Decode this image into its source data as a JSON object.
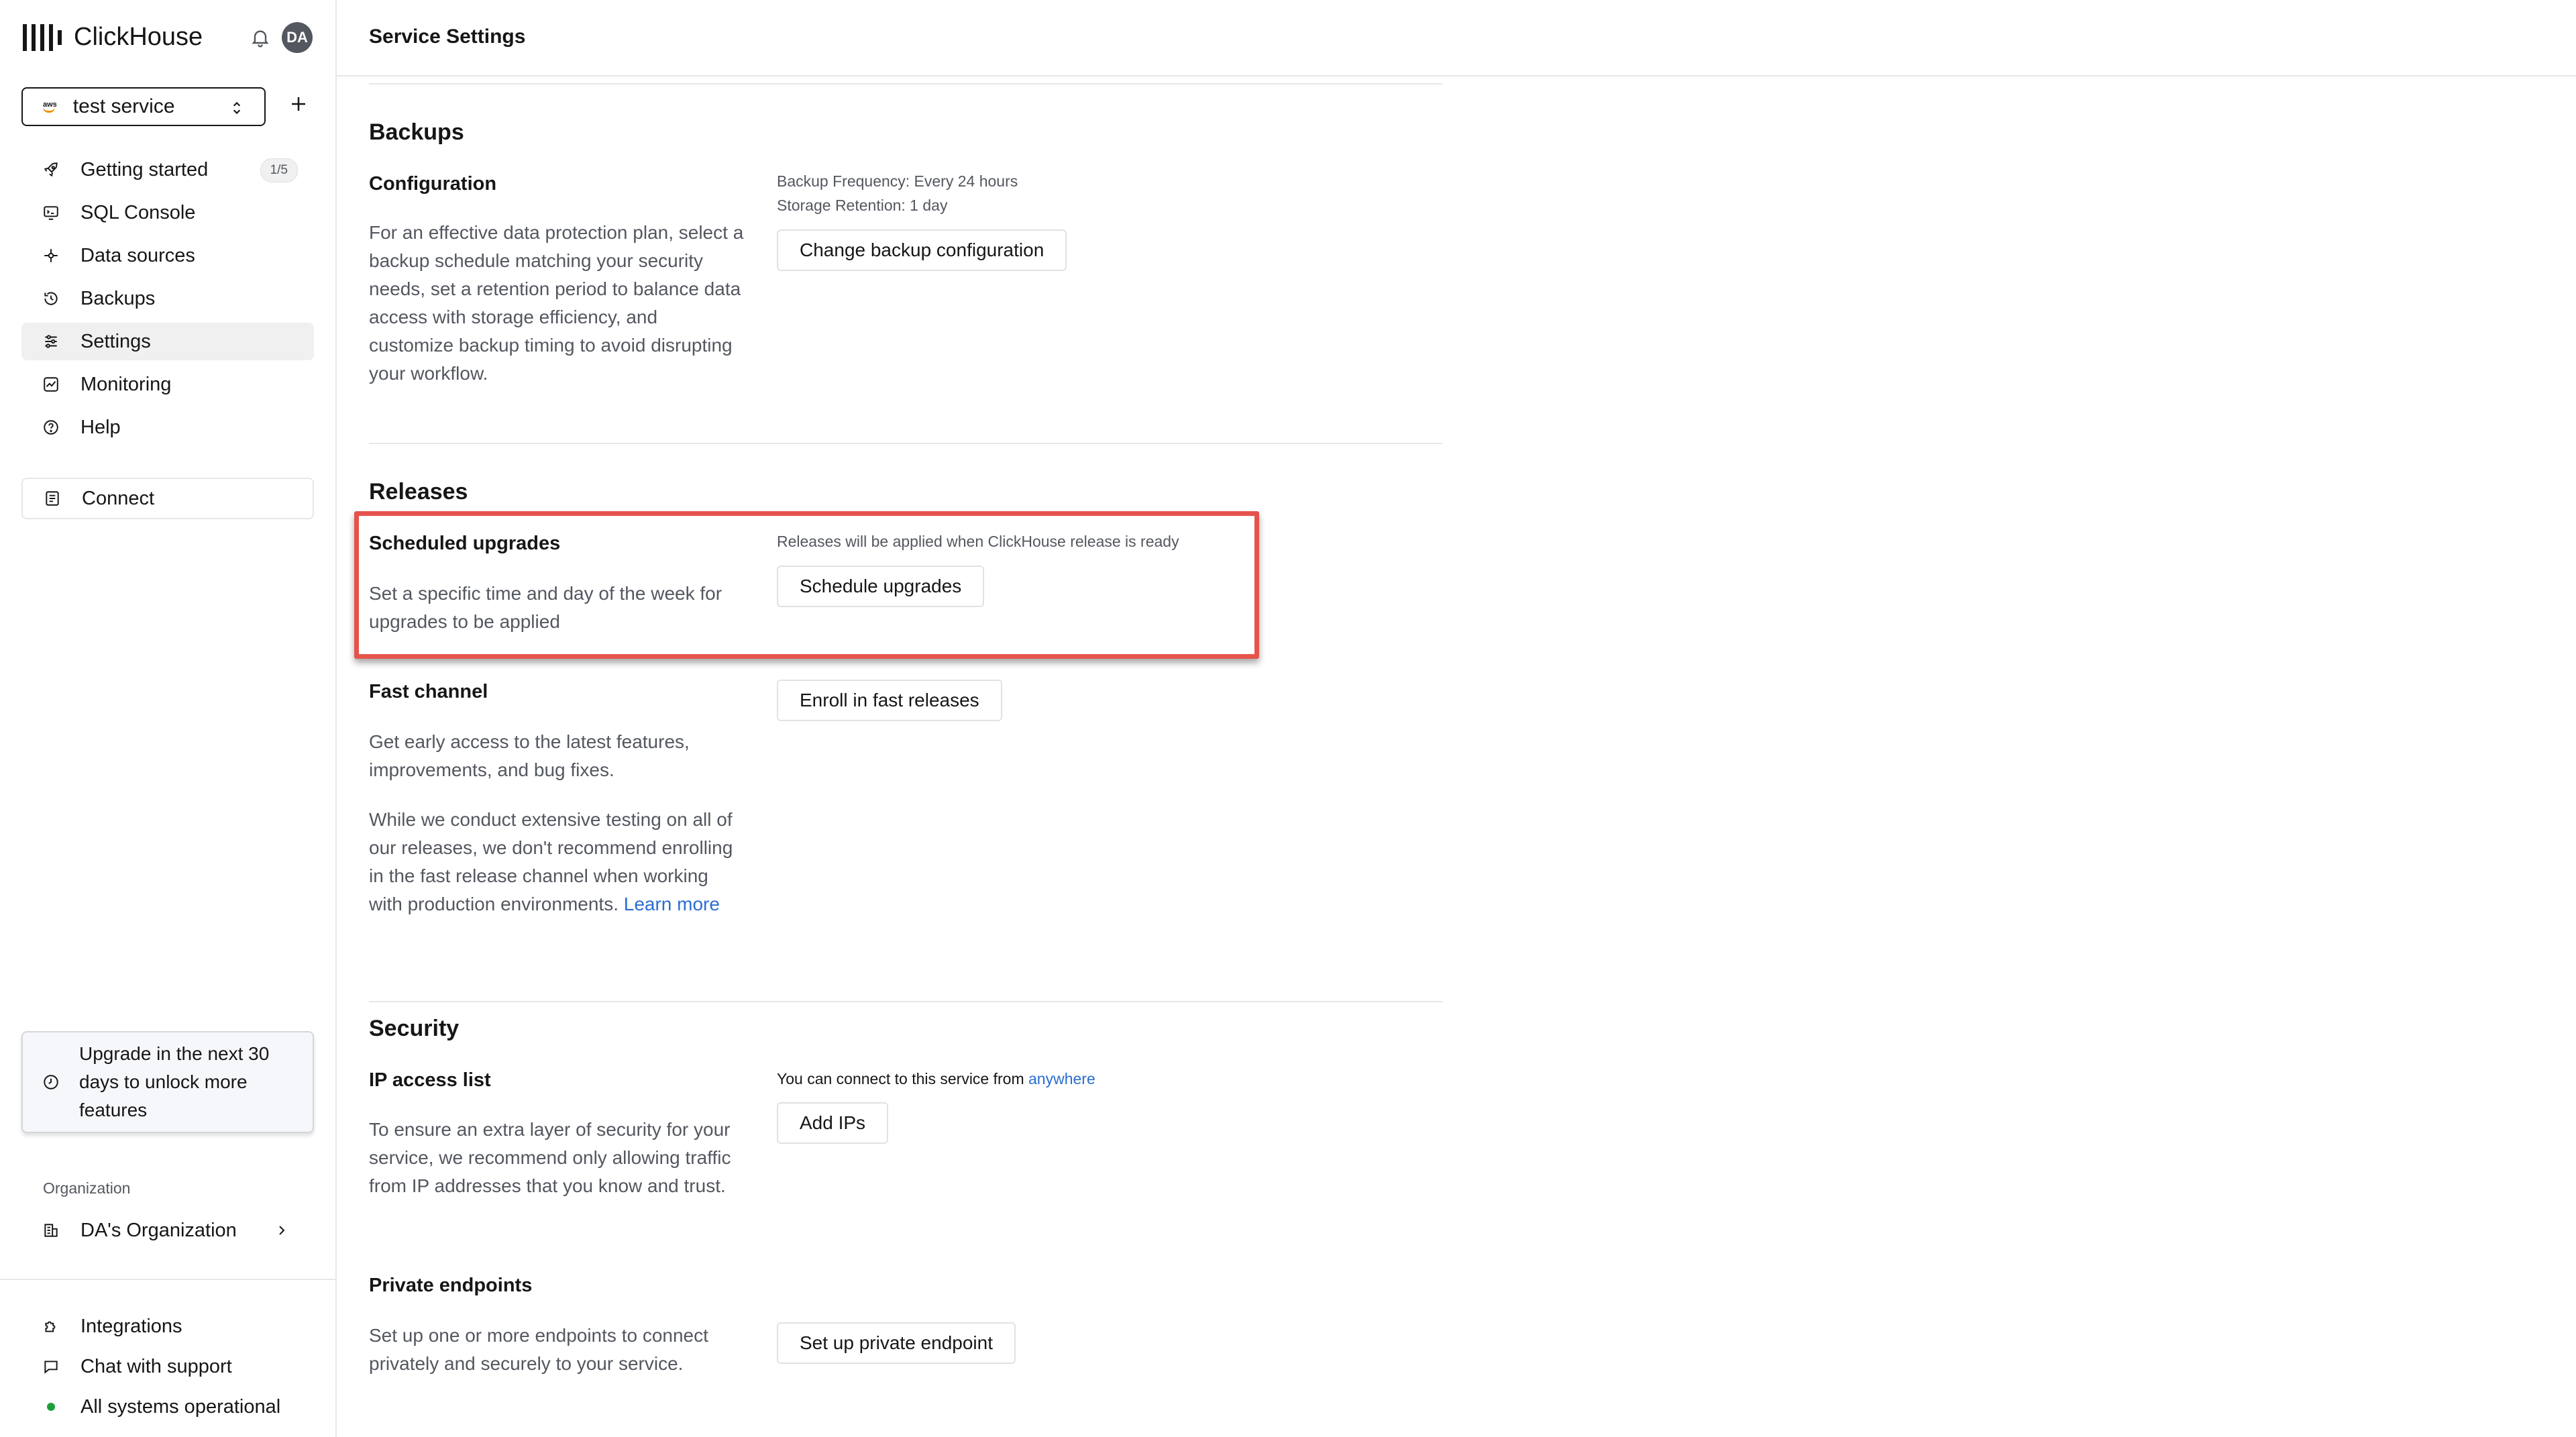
{
  "app": {
    "brand": "ClickHouse",
    "page_title": "Service Settings"
  },
  "user": {
    "initials": "DA"
  },
  "service": {
    "name": "test service",
    "provider_badge": "aws"
  },
  "sidebar": {
    "items": [
      {
        "label": "Getting started",
        "icon": "rocket-icon",
        "badge": "1/5"
      },
      {
        "label": "SQL Console",
        "icon": "console-icon"
      },
      {
        "label": "Data sources",
        "icon": "data-sources-icon"
      },
      {
        "label": "Backups",
        "icon": "backup-icon"
      },
      {
        "label": "Settings",
        "icon": "sliders-icon",
        "active": true
      },
      {
        "label": "Monitoring",
        "icon": "monitoring-icon"
      },
      {
        "label": "Help",
        "icon": "help-icon"
      }
    ],
    "connect_label": "Connect",
    "upgrade_text": "Upgrade in the next 30 days to unlock more features",
    "organization_label": "Organization",
    "organization_name": "DA's Organization",
    "bottom": {
      "integrations": "Integrations",
      "chat": "Chat with support",
      "status": "All systems operational"
    }
  },
  "backups": {
    "title": "Backups",
    "config_title": "Configuration",
    "config_desc": "For an effective data protection plan, select a backup schedule matching your security needs, set a retention period to balance data access with storage efficiency, and customize backup timing to avoid disrupting your workflow.",
    "frequency": "Backup Frequency: Every 24 hours",
    "retention": "Storage Retention: 1 day",
    "button": "Change backup configuration"
  },
  "releases": {
    "title": "Releases",
    "scheduled_title": "Scheduled upgrades",
    "scheduled_desc": "Set a specific time and day of the week for upgrades to be applied",
    "scheduled_note": "Releases will be applied when ClickHouse release is ready",
    "scheduled_button": "Schedule upgrades",
    "fast_title": "Fast channel",
    "fast_desc1": "Get early access to the latest features, improvements, and bug fixes.",
    "fast_desc2": "While we conduct extensive testing on all of our releases, we don't recommend enrolling in the fast release channel when working with production environments.",
    "learn_more": "Learn more",
    "fast_button": "Enroll in fast releases"
  },
  "security": {
    "title": "Security",
    "ip_title": "IP access list",
    "ip_desc": "To ensure an extra layer of security for your service, we recommend only allowing traffic from IP addresses that you know and trust.",
    "ip_note_prefix": "You can connect to this service from",
    "ip_note_link": "anywhere",
    "ip_button": "Add IPs",
    "pe_title": "Private endpoints",
    "pe_desc": "Set up one or more endpoints to connect privately and securely to your service.",
    "pe_button": "Set up private endpoint"
  },
  "colors": {
    "highlight": "#e5534b",
    "link": "#2b6dd1",
    "status_ok": "#1f9d3a"
  }
}
